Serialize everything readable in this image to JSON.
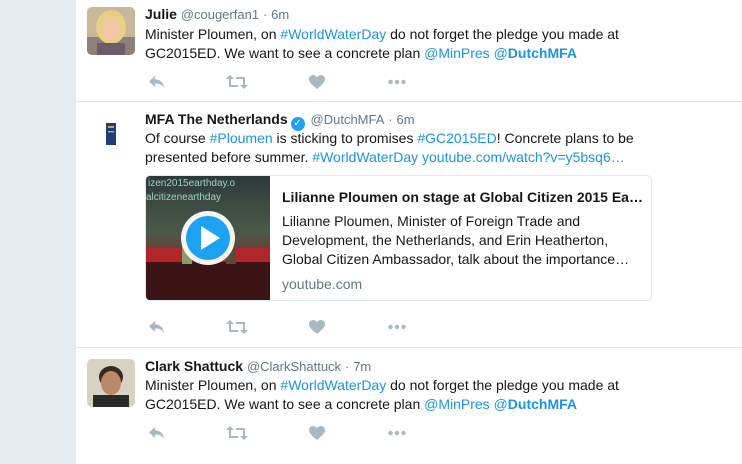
{
  "tweets": [
    {
      "name": "Julie",
      "handle": "@cougerfan1",
      "time": "6m",
      "text_parts": [
        "Minister Ploumen, on ",
        "#WorldWaterDay",
        " do not forget the pledge you made at GC2015ED. We want to see a concrete plan ",
        "@MinPres",
        " @",
        "DutchMFA"
      ]
    },
    {
      "name": "MFA The Netherlands",
      "handle": "@DutchMFA",
      "time": "6m",
      "verified": true,
      "text_parts": [
        "Of course ",
        "#Ploumen",
        " is sticking to promises ",
        "#GC2015ED",
        "! Concrete plans to be presented before summer. ",
        "#WorldWaterDay",
        " ",
        "youtube.com/watch?v=y5bsq6…"
      ],
      "card": {
        "title": "Lilianne Ploumen on stage at Global Citizen 2015 Ea…",
        "description": "Lilianne Ploumen, Minister of Foreign Trade and Development, the Netherlands, and Erin Heatherton, Global Citizen Ambassador, talk about the importance…",
        "domain": "youtube.com",
        "thumb_text": [
          "izen2015earthday.o",
          "alcitizenearthday"
        ]
      }
    },
    {
      "name": "Clark Shattuck",
      "handle": "@ClarkShattuck",
      "time": "7m",
      "text_parts": [
        "Minister Ploumen, on ",
        "#WorldWaterDay",
        " do not forget the pledge you made at GC2015ED. We want to see a concrete plan ",
        "@MinPres",
        " @",
        "DutchMFA"
      ]
    }
  ],
  "separator": "·",
  "icons": [
    "reply-icon",
    "retweet-icon",
    "like-icon",
    "more-icon"
  ],
  "colors": {
    "link": "#1b95e0",
    "meta": "#657786",
    "icon": "#aab8c2",
    "verified": "#1da1f2"
  }
}
